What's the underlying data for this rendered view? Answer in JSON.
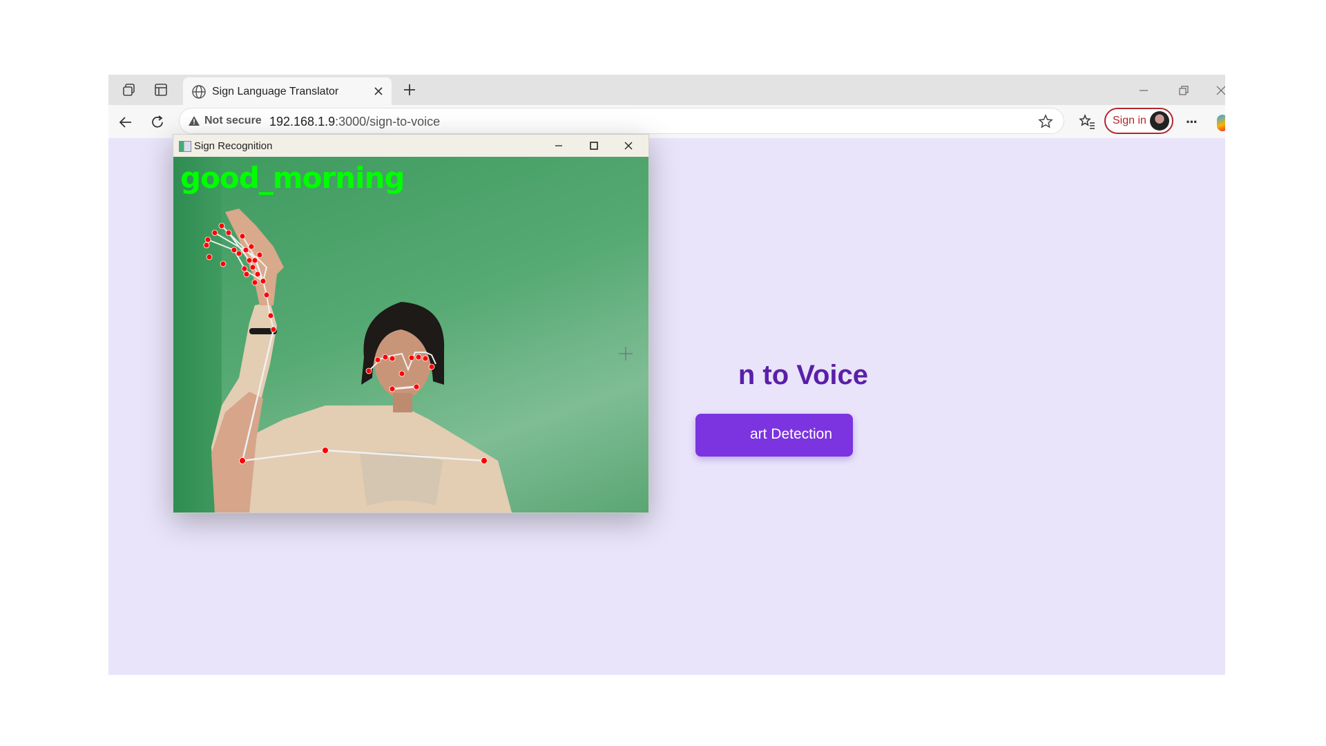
{
  "browser": {
    "tab": {
      "title": "Sign Language Translator"
    },
    "address": {
      "security_label": "Not secure",
      "url_host": "192.168.1.9",
      "url_rest": ":3000/sign-to-voice"
    },
    "signin_label": "Sign in",
    "more_label": "···"
  },
  "page": {
    "heading_visible": "n to Voice",
    "start_button_visible": "art Detection",
    "accent": "#7b34e0",
    "heading_color": "#5a1fa8",
    "background": "#e9e4fa"
  },
  "cv_window": {
    "title": "Sign Recognition",
    "prediction": "good_morning",
    "prediction_color": "#00ff00",
    "landmark_color": "#ff0000"
  }
}
